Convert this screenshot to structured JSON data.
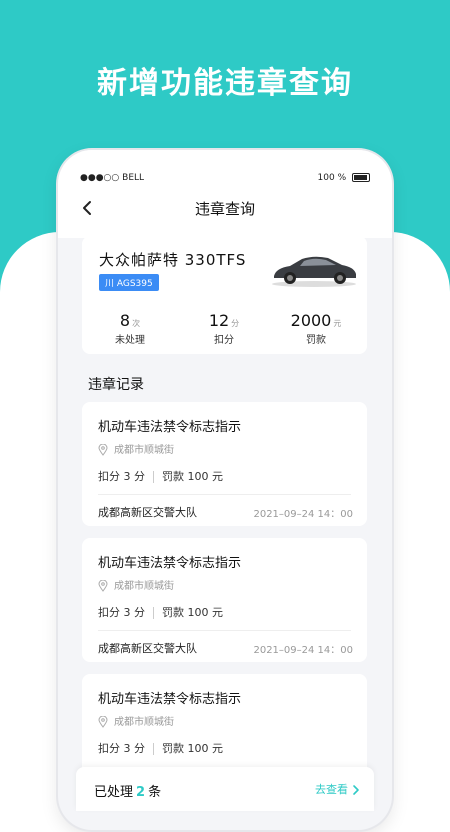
{
  "headline": "新增功能违章查询",
  "status_bar": {
    "carrier": "BELL",
    "battery": "100 %"
  },
  "nav": {
    "title": "违章查询"
  },
  "car": {
    "name": "大众帕萨特 330TFS",
    "plate": "川 AGS395",
    "stats": [
      {
        "value": "8",
        "unit": "次",
        "label": "未处理"
      },
      {
        "value": "12",
        "unit": "分",
        "label": "扣分"
      },
      {
        "value": "2000",
        "unit": "元",
        "label": "罚款"
      }
    ]
  },
  "records_title": "违章记录",
  "records": [
    {
      "title": "机动车违法禁令标志指示",
      "location": "成都市顺城街",
      "points": "扣分 3 分",
      "fine": "罚款 100 元",
      "office": "成都高新区交警大队",
      "time": "2021–09–24 14：00"
    },
    {
      "title": "机动车违法禁令标志指示",
      "location": "成都市顺城街",
      "points": "扣分 3 分",
      "fine": "罚款 100 元",
      "office": "成都高新区交警大队",
      "time": "2021–09–24 14：00"
    },
    {
      "title": "机动车违法禁令标志指示",
      "location": "成都市顺城街",
      "points": "扣分 3 分",
      "fine": "罚款 100 元",
      "office": "",
      "time": ""
    }
  ],
  "bottom": {
    "processed_prefix": "已处理",
    "processed_count": "2",
    "processed_suffix": "条",
    "view_label": "去查看"
  },
  "colors": {
    "accent": "#2ECAC6",
    "plate_bg": "#3B8CF5"
  }
}
